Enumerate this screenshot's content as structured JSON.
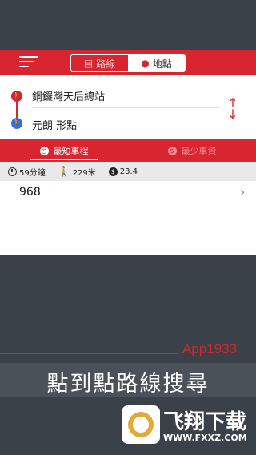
{
  "header": {
    "tabs": [
      {
        "label": "路線",
        "icon": "bus-icon",
        "active": false
      },
      {
        "label": "地點",
        "icon": "location-pin-icon",
        "active": true
      }
    ]
  },
  "route": {
    "from": "銅鑼灣天后總站",
    "to": "元朗 形點"
  },
  "sort_tabs": [
    {
      "label": "最短車程",
      "icon": "clock-icon",
      "active": true
    },
    {
      "label": "最少車資",
      "icon": "dollar-icon",
      "active": false
    }
  ],
  "summary": {
    "duration": "59分鐘",
    "walk": "229米",
    "fare": "23.4"
  },
  "results": [
    {
      "route": "968"
    }
  ],
  "promo": {
    "brand": "App1933",
    "caption": "點到點路線搜尋",
    "watermark_title": "飞翔下载",
    "watermark_url": "WWW.FXXZ.COM"
  },
  "colors": {
    "accent": "#d9252f",
    "background": "#3a4148",
    "stats_bar": "#e9e9ea"
  }
}
